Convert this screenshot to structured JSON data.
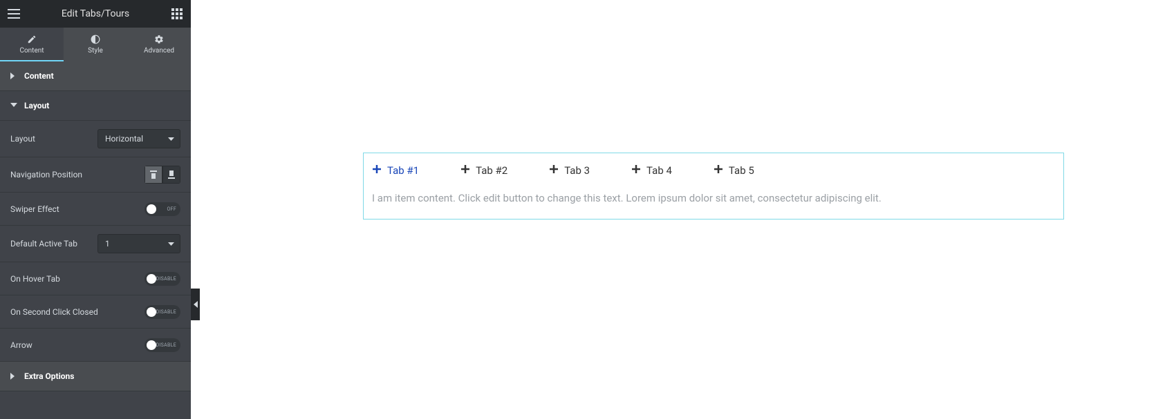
{
  "header": {
    "title": "Edit Tabs/Tours"
  },
  "panelTabs": {
    "content": "Content",
    "style": "Style",
    "advanced": "Advanced"
  },
  "sections": {
    "content": "Content",
    "layout": "Layout",
    "extraOptions": "Extra Options"
  },
  "controls": {
    "layout": {
      "label": "Layout",
      "value": "Horizontal"
    },
    "navPos": {
      "label": "Navigation Position"
    },
    "swiper": {
      "label": "Swiper Effect",
      "state": "OFF"
    },
    "defaultActive": {
      "label": "Default Active Tab",
      "value": "1"
    },
    "onHover": {
      "label": "On Hover Tab",
      "state": "DISABLE"
    },
    "secondClick": {
      "label": "On Second Click Closed",
      "state": "DISABLE"
    },
    "arrow": {
      "label": "Arrow",
      "state": "DISABLE"
    }
  },
  "preview": {
    "tabs": [
      "Tab #1",
      "Tab #2",
      "Tab 3",
      "Tab 4",
      "Tab 5"
    ],
    "content": "I am item content. Click edit button to change this text. Lorem ipsum dolor sit amet, consectetur adipiscing elit."
  }
}
